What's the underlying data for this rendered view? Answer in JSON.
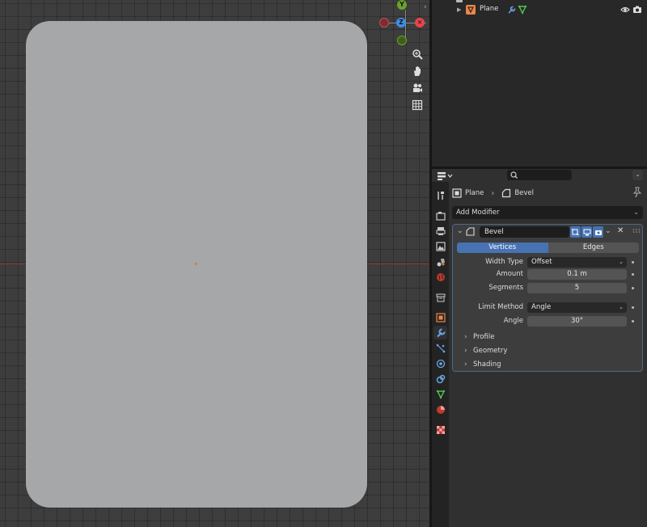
{
  "outliner": {
    "object_name": "Plane"
  },
  "gizmo": {
    "y": "Y",
    "z": "Z"
  },
  "properties": {
    "breadcrumb": {
      "object": "Plane",
      "modifier": "Bevel"
    },
    "add_modifier_label": "Add Modifier",
    "modifier": {
      "name": "Bevel",
      "mode_tabs": [
        "Vertices",
        "Edges"
      ],
      "active_tab": "Vertices",
      "width_type": {
        "label": "Width Type",
        "value": "Offset"
      },
      "amount": {
        "label": "Amount",
        "value": "0.1 m"
      },
      "segments": {
        "label": "Segments",
        "value": "5"
      },
      "limit_method": {
        "label": "Limit Method",
        "value": "Angle"
      },
      "angle": {
        "label": "Angle",
        "value": "30°"
      },
      "subpanels": [
        "Profile",
        "Geometry",
        "Shading"
      ]
    }
  },
  "colors": {
    "accent": "#4772b3",
    "object_orange": "#e9874a",
    "mesh_green": "#4fc14f",
    "axis_x": "#e8434f",
    "axis_y": "#6aa22b",
    "axis_z": "#3f8ee8"
  }
}
